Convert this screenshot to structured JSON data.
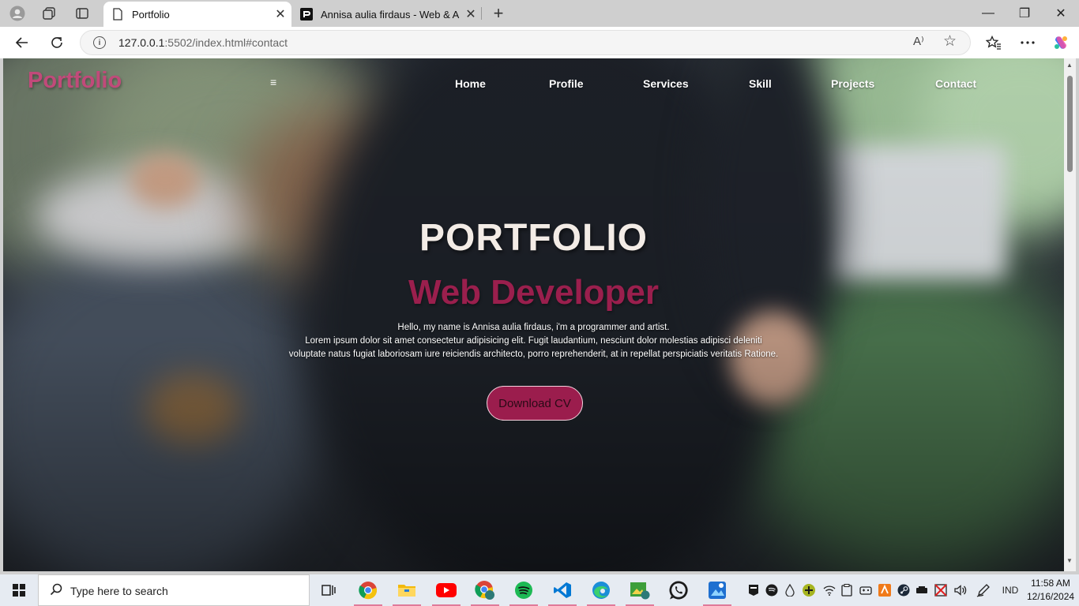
{
  "browser": {
    "tabs": [
      {
        "title": "Portfolio",
        "active": true
      },
      {
        "title": "Annisa aulia firdaus - Web & App",
        "active": false
      }
    ],
    "new_tab_label": "+",
    "window_controls": {
      "minimize": "—",
      "maximize": "❐",
      "close": "✕"
    },
    "address": {
      "host": "127.0.0.1",
      "rest": ":5502/index.html#contact"
    },
    "read_aloud_label": "A⁾",
    "icons": {
      "profile": "profile-icon",
      "workspaces": "workspaces-icon",
      "tab_actions": "tab-actions-icon",
      "back": "back-arrow-icon",
      "refresh": "refresh-icon",
      "favorites": "favorites-icon",
      "menu": "more-icon",
      "copilot": "copilot-icon"
    }
  },
  "page": {
    "logo": "Portfolio",
    "menu_toggle": "≡",
    "nav": [
      "Home",
      "Profile",
      "Services",
      "Skill",
      "Projects",
      "Contact"
    ],
    "hero": {
      "title": "PORTFOLIO",
      "subtitle": "Web Developer",
      "lines": [
        "Hello, my name is Annisa aulia firdaus, i'm a programmer and artist.",
        "Lorem ipsum dolor sit amet consectetur adipisicing elit. Fugit laudantium, nesciunt dolor molestias adipisci deleniti",
        "voluptate natus fugiat laboriosam iure reiciendis architecto, porro reprehenderit, at in repellat perspiciatis veritatis Ratione."
      ],
      "cta": "Download CV"
    },
    "colors": {
      "logo": "#c14a7a",
      "accent": "#9a1f4d",
      "button": "#9b1d4d"
    }
  },
  "taskbar": {
    "search_placeholder": "Type here to search",
    "apps": [
      "task-view",
      "chrome",
      "file-explorer",
      "youtube",
      "chrome-profile",
      "spotify",
      "vscode",
      "edge",
      "photos",
      "whatsapp",
      "paint"
    ],
    "tray_language": "IND",
    "clock_time": "11:58 AM",
    "clock_date": "12/16/2024"
  }
}
